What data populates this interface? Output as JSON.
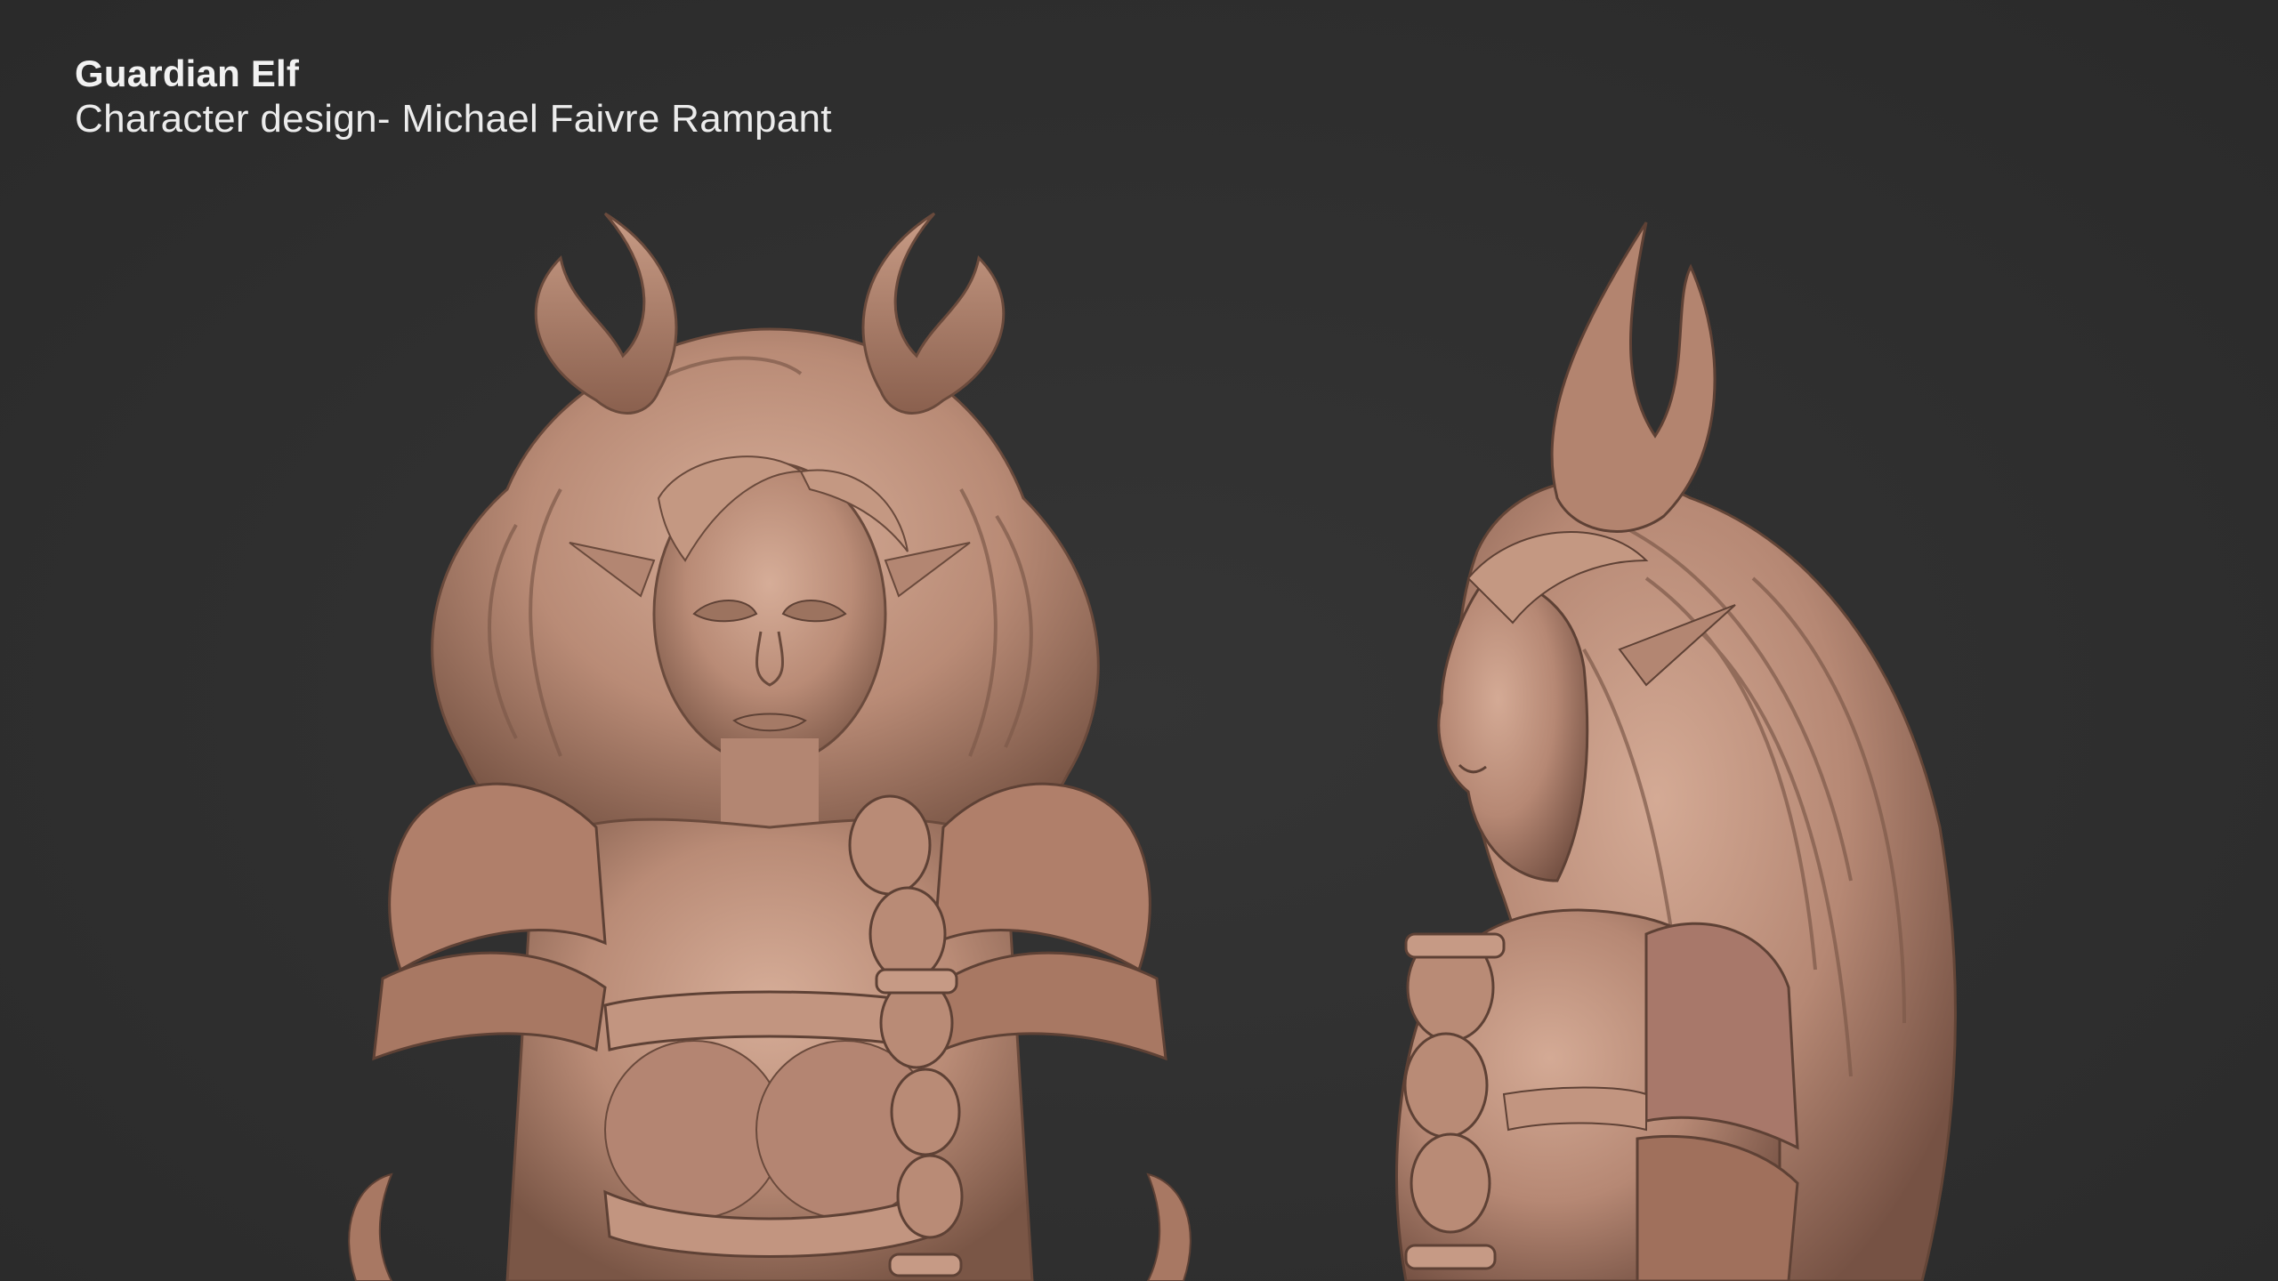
{
  "caption": {
    "title": "Guardian Elf",
    "subtitle": "Character design- Michael Faivre Rampant"
  },
  "renders": [
    {
      "view": "front"
    },
    {
      "view": "side"
    }
  ],
  "colors": {
    "background": "#2f2f2f",
    "clay": "#b98b76",
    "clay_shadow": "#7a5646",
    "clay_highlight": "#d6ad98",
    "caption_text": "#f2f2f2"
  }
}
